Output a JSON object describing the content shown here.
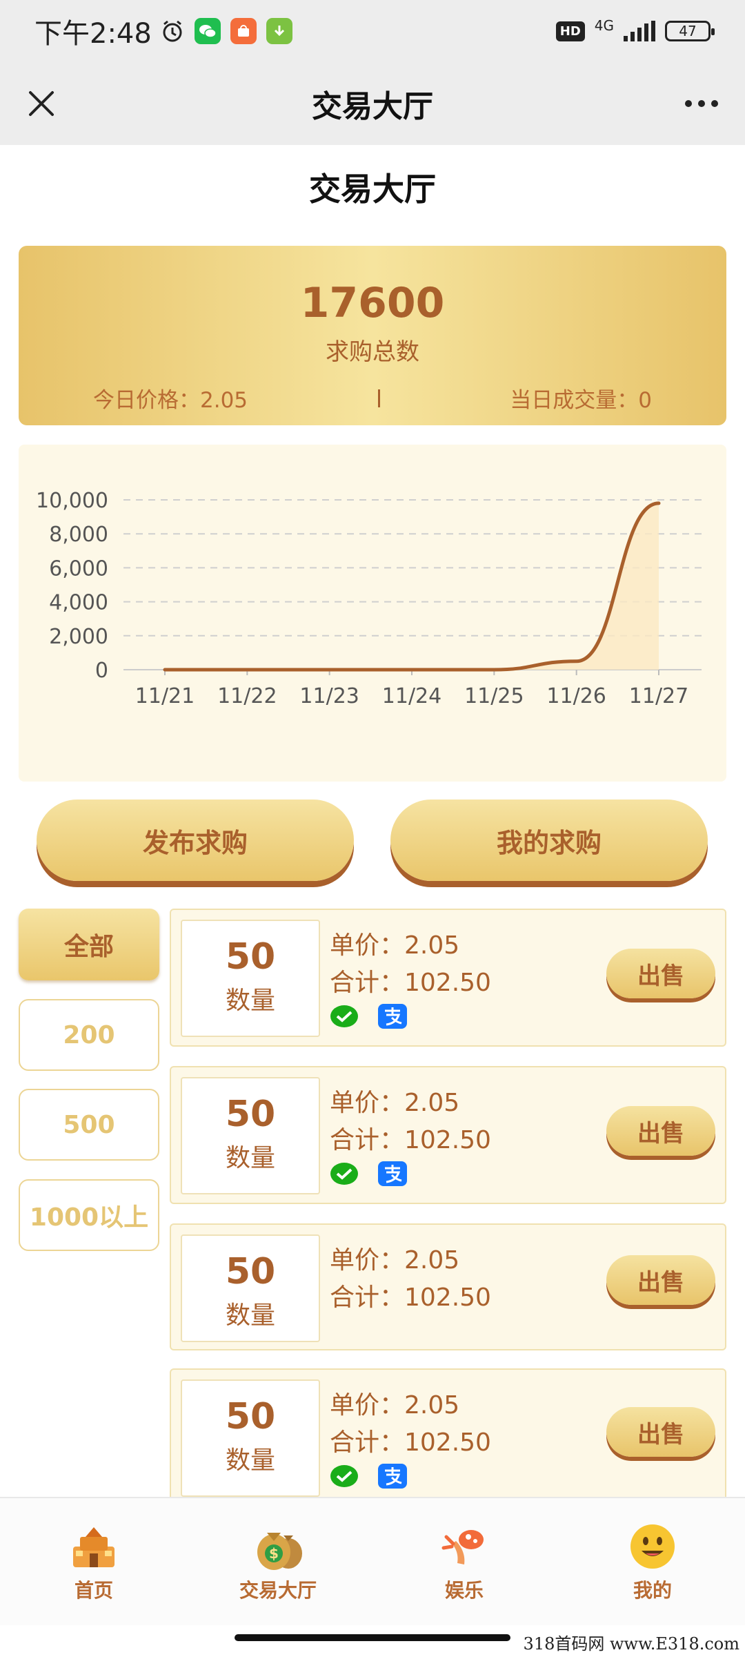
{
  "status_bar": {
    "time": "下午2:48",
    "hd": "HD",
    "network": "4G",
    "battery": "47"
  },
  "nav": {
    "title": "交易大厅"
  },
  "page_title": "交易大厅",
  "summary": {
    "total_value": "17600",
    "total_label": "求购总数",
    "price_text": "今日价格：2.05",
    "volume_text": "当日成交量：0"
  },
  "chart_data": {
    "type": "area",
    "categories": [
      "11/21",
      "11/22",
      "11/23",
      "11/24",
      "11/25",
      "11/26",
      "11/27"
    ],
    "values": [
      0,
      0,
      0,
      0,
      0,
      500,
      9800
    ],
    "y_ticks": [
      "10,000",
      "8,000",
      "6,000",
      "4,000",
      "2,000",
      "0"
    ],
    "ylim": [
      0,
      10000
    ],
    "grid": true,
    "line_color": "#a9602c",
    "fill_color": "#fbe9c3"
  },
  "actions": {
    "publish": "发布求购",
    "mine": "我的求购"
  },
  "filters": [
    "全部",
    "200",
    "500",
    "1000以上"
  ],
  "orders": [
    {
      "qty": "50",
      "qty_label": "数量",
      "price": "单价：2.05",
      "total": "合计：102.50",
      "sell": "出售",
      "pay": true
    },
    {
      "qty": "50",
      "qty_label": "数量",
      "price": "单价：2.05",
      "total": "合计：102.50",
      "sell": "出售",
      "pay": true
    },
    {
      "qty": "50",
      "qty_label": "数量",
      "price": "单价：2.05",
      "total": "合计：102.50",
      "sell": "出售",
      "pay": false
    },
    {
      "qty": "50",
      "qty_label": "数量",
      "price": "单价：2.05",
      "total": "合计：102.50",
      "sell": "出售",
      "pay": true
    }
  ],
  "tabs": [
    {
      "label": "首页",
      "icon": "home-icon"
    },
    {
      "label": "交易大厅",
      "icon": "money-bag-icon"
    },
    {
      "label": "娱乐",
      "icon": "entertainment-icon"
    },
    {
      "label": "我的",
      "icon": "profile-icon"
    }
  ],
  "watermark": "318首码网 www.E318.com",
  "colors": {
    "brand_brown": "#a9602c",
    "gold": "#e9c66b",
    "light_gold": "#f6e3a2",
    "card_bg": "#fdf8e7"
  }
}
